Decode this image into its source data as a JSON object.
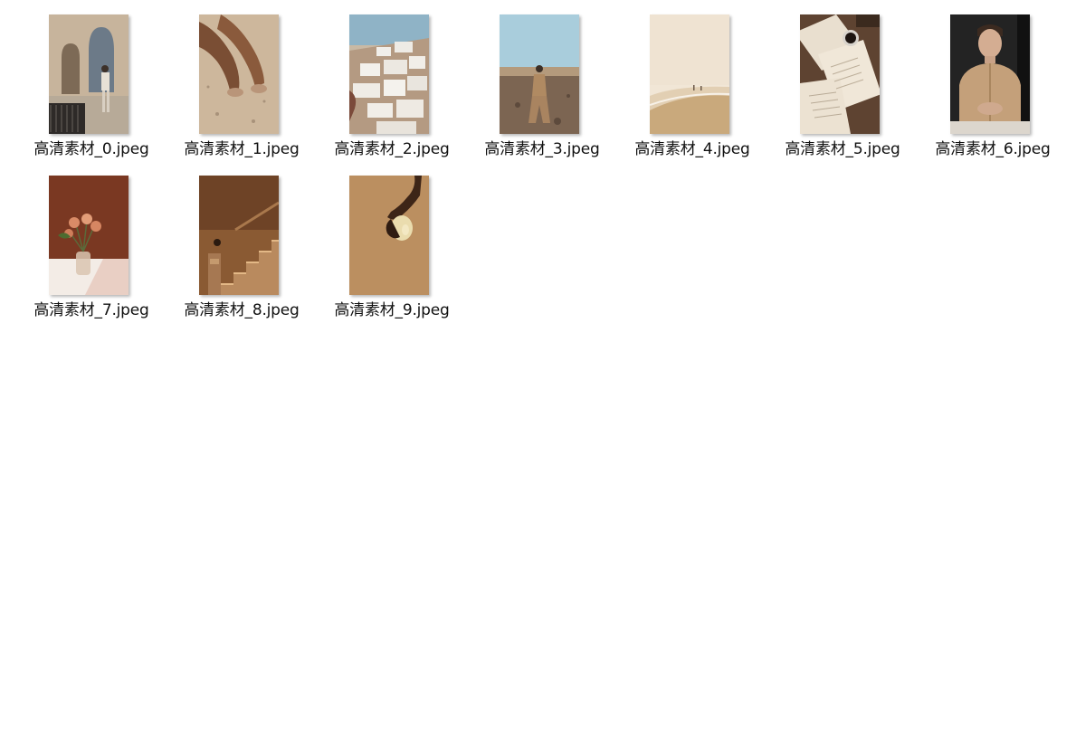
{
  "files": [
    {
      "name": "高清素材_0.jpeg",
      "thumbnail": "street-building-man-photo"
    },
    {
      "name": "高清素材_1.jpeg",
      "thumbnail": "legs-on-sand-photo"
    },
    {
      "name": "高清素材_2.jpeg",
      "thumbnail": "white-hillside-village-photo"
    },
    {
      "name": "高清素材_3.jpeg",
      "thumbnail": "man-in-desert-photo"
    },
    {
      "name": "高清素材_4.jpeg",
      "thumbnail": "misty-beach-photo"
    },
    {
      "name": "高清素材_5.jpeg",
      "thumbnail": "open-books-coffee-photo"
    },
    {
      "name": "高清素材_6.jpeg",
      "thumbnail": "man-beige-jacket-portrait-photo"
    },
    {
      "name": "高清素材_7.jpeg",
      "thumbnail": "roses-in-vase-photo"
    },
    {
      "name": "高清素材_8.jpeg",
      "thumbnail": "stone-staircase-photo"
    },
    {
      "name": "高清素材_9.jpeg",
      "thumbnail": "hand-holding-fruit-photo"
    }
  ]
}
